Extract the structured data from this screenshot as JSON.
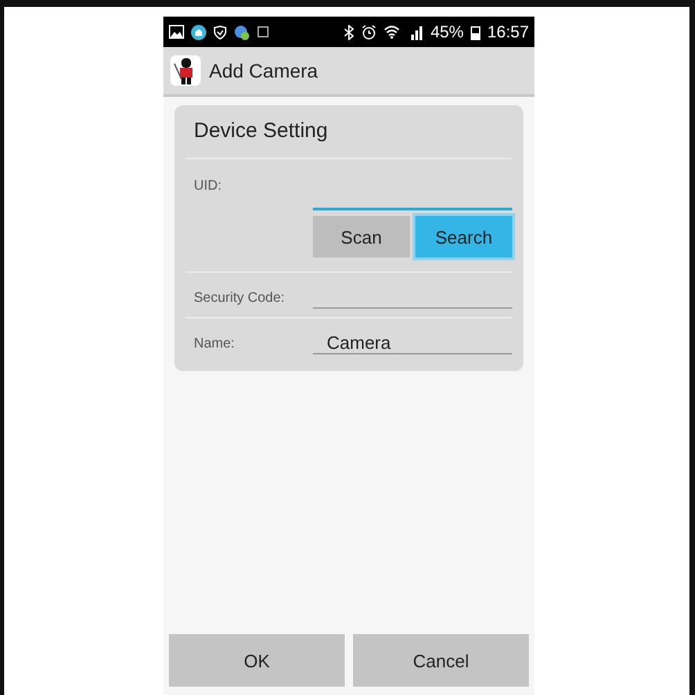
{
  "status_bar": {
    "battery": "45%",
    "time": "16:57"
  },
  "app_bar": {
    "title": "Add Camera"
  },
  "card": {
    "title": "Device Setting",
    "uid": {
      "label": "UID:",
      "focused": true
    },
    "uid_buttons": [
      {
        "label": "Scan",
        "selected": false
      },
      {
        "label": "Search",
        "selected": true
      }
    ],
    "security_code": {
      "label": "Security Code:"
    },
    "name": {
      "label": "Name:",
      "value": "Camera"
    }
  },
  "buttons": [
    "OK",
    "Cancel"
  ]
}
